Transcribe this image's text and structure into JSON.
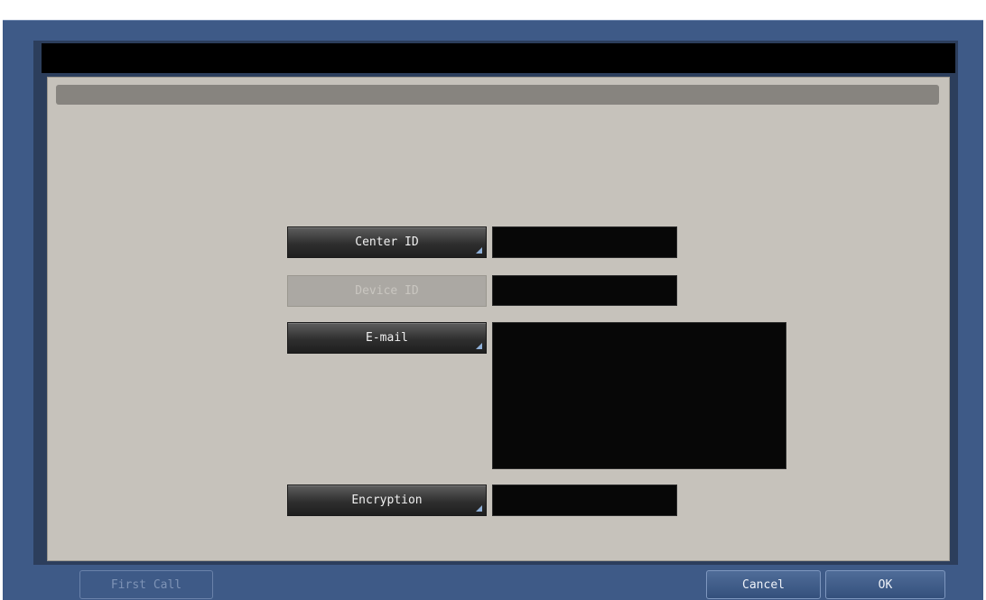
{
  "fields": [
    {
      "label": "Center ID",
      "value": "",
      "enabled": true
    },
    {
      "label": "Device ID",
      "value": "",
      "enabled": false
    },
    {
      "label": "E-mail",
      "value": "",
      "enabled": true
    },
    {
      "label": "Encryption",
      "value": "",
      "enabled": true
    }
  ],
  "footer": {
    "first_call_label": "First Call",
    "cancel_label": "Cancel",
    "ok_label": "OK"
  },
  "colors": {
    "frame": "#3e5a87",
    "content": "#c6c2bb",
    "button_corner_marker": "#8fb0d8"
  }
}
